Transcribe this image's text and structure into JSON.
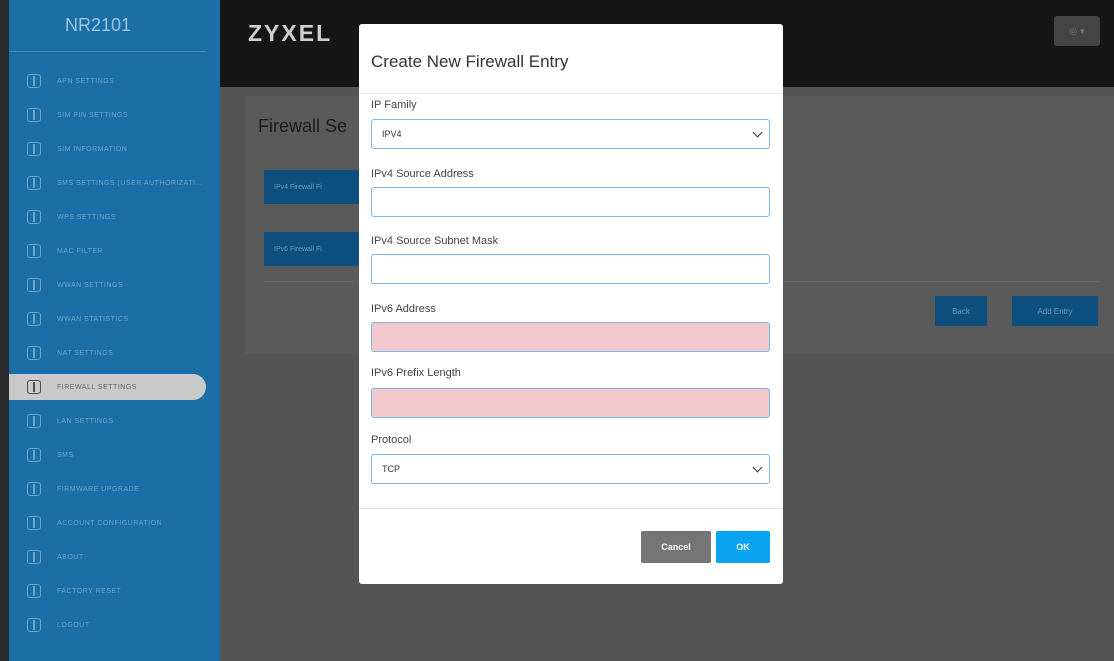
{
  "sidebar": {
    "brand": "NR2101",
    "items": [
      {
        "label": "APN SETTINGS",
        "icon": "box-icon"
      },
      {
        "label": "SIM PIN SETTINGS",
        "icon": "box-icon"
      },
      {
        "label": "SIM INFORMATION",
        "icon": "box-icon"
      },
      {
        "label": "SMS SETTINGS (USER AUTHORIZATION)",
        "icon": "box-icon"
      },
      {
        "label": "WPS SETTINGS",
        "icon": "box-icon"
      },
      {
        "label": "MAC FILTER",
        "icon": "box-icon"
      },
      {
        "label": "WWAN SETTINGS",
        "icon": "box-icon"
      },
      {
        "label": "WWAN STATISTICS",
        "icon": "box-icon"
      },
      {
        "label": "NAT SETTINGS",
        "icon": "box-icon"
      },
      {
        "label": "FIREWALL SETTINGS",
        "icon": "box-icon",
        "active": true
      },
      {
        "label": "LAN SETTINGS",
        "icon": "box-icon"
      },
      {
        "label": "SMS",
        "icon": "box-icon"
      },
      {
        "label": "FIRMWARE UPGRADE",
        "icon": "box-icon"
      },
      {
        "label": "ACCOUNT CONFIGURATION",
        "icon": "box-icon"
      },
      {
        "label": "ABOUT",
        "icon": "box-icon"
      },
      {
        "label": "FACTORY RESET",
        "icon": "box-icon"
      },
      {
        "label": "LOGOUT",
        "icon": "box-icon"
      }
    ]
  },
  "header": {
    "logo": "ZYXEL",
    "user_icon": "user-icon"
  },
  "content": {
    "title": "Firewall Se",
    "ipv4_button": "IPv4 Firewall Fi",
    "ipv6_button": "IPv6 Firewall Fi",
    "back_button": "Back",
    "add_entry_button": "Add Entry"
  },
  "modal": {
    "title": "Create New Firewall Entry",
    "ip_family_label": "IP Family",
    "ip_family_value": "IPV4",
    "ipv4_src_label": "IPv4 Source Address",
    "ipv4_src_value": "",
    "ipv4_mask_label": "IPv4 Source Subnet Mask",
    "ipv4_mask_value": "",
    "ipv6_addr_label": "IPv6 Address",
    "ipv6_addr_value": "",
    "ipv6_prefix_label": "IPv6 Prefix Length",
    "ipv6_prefix_value": "",
    "protocol_label": "Protocol",
    "protocol_value": "TCP",
    "cancel_label": "Cancel",
    "ok_label": "OK"
  },
  "colors": {
    "sidebar": "#1b6fa6",
    "topbar": "#161616",
    "ok": "#0aa3f0",
    "cancel": "#757575",
    "invalid_field": "#f2c8cc"
  }
}
